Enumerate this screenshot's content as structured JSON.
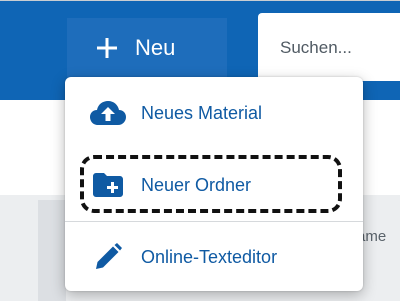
{
  "toolbar": {
    "new_label": "Neu",
    "search_placeholder": "Suchen..."
  },
  "table": {
    "partial_header": "ame"
  },
  "menu": {
    "items": [
      {
        "label": "Neues Material",
        "icon": "cloud-upload-icon"
      },
      {
        "label": "Neuer Ordner",
        "icon": "folder-plus-icon"
      },
      {
        "label": "Online-Texteditor",
        "icon": "pencil-icon"
      }
    ]
  },
  "colors": {
    "primary": "#0f65b5",
    "menu_text": "#0f5aa3"
  }
}
